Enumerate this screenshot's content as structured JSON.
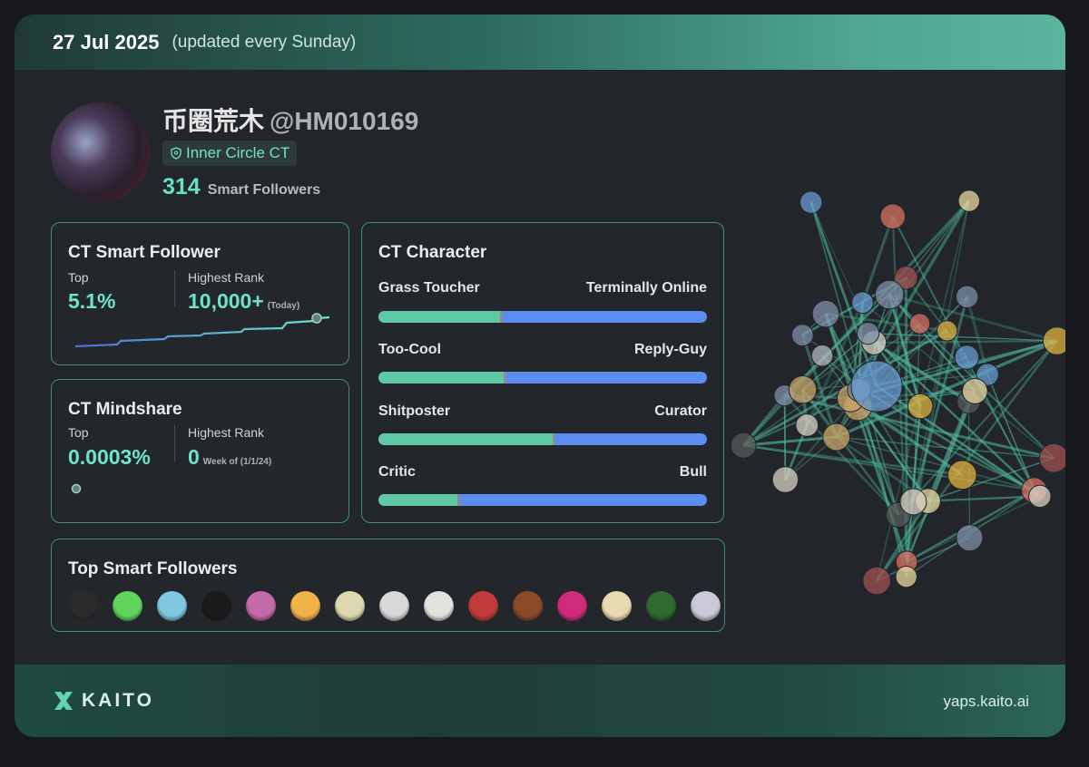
{
  "header": {
    "date": "27 Jul 2025",
    "update_note": "(updated every Sunday)"
  },
  "profile": {
    "name": "币圈荒木",
    "handle": "@HM010169",
    "badge": "Inner Circle CT",
    "smart_followers_count": "314",
    "smart_followers_label": "Smart Followers"
  },
  "smart_follower": {
    "title": "CT Smart Follower",
    "top_label": "Top",
    "top_value": "5.1%",
    "rank_label": "Highest Rank",
    "rank_value": "10,000+",
    "rank_note": "(Today)"
  },
  "mindshare": {
    "title": "CT Mindshare",
    "top_label": "Top",
    "top_value": "0.0003%",
    "rank_label": "Highest Rank",
    "rank_value": "0",
    "rank_note": "Week of (1/1/24)"
  },
  "character": {
    "title": "CT Character",
    "traits": [
      {
        "left": "Grass Toucher",
        "right": "Terminally Online",
        "value": 0.37
      },
      {
        "left": "Too-Cool",
        "right": "Reply-Guy",
        "value": 0.38
      },
      {
        "left": "Shitposter",
        "right": "Curator",
        "value": 0.53
      },
      {
        "left": "Critic",
        "right": "Bull",
        "value": 0.24
      }
    ]
  },
  "top_followers": {
    "title": "Top Smart Followers",
    "avatar_colors": [
      "#2b2b2b",
      "#5fd35a",
      "#7fc7e0",
      "#1a1a1a",
      "#c56aa8",
      "#f2b24a",
      "#ded8b0",
      "#d8d8d8",
      "#e3e1de",
      "#c23a3a",
      "#8a4a2a",
      "#d02a7a",
      "#e9d9b0",
      "#2f6a2f",
      "#c9c9d9"
    ]
  },
  "colors": {
    "accent": "#6fe3c8",
    "bar_left": "#5fc8a4",
    "bar_right": "#5b8cf0",
    "panel_border": "#3f8f7c"
  },
  "footer": {
    "brand": "KAITO",
    "site": "yaps.kaito.ai"
  }
}
